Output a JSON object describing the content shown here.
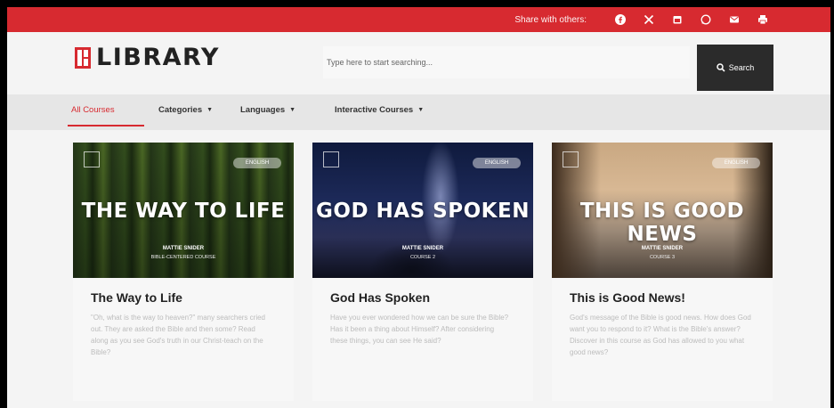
{
  "topbar": {
    "share_label": "Share with others:",
    "icons": [
      "facebook-icon",
      "x-icon",
      "calendar-icon",
      "whatsapp-icon",
      "email-icon",
      "print-icon"
    ]
  },
  "header": {
    "logo_text": "LIBRARY",
    "search_placeholder": "Type here to start searching...",
    "search_button": "Search"
  },
  "nav": {
    "items": [
      {
        "label": "All Courses",
        "active": true
      },
      {
        "label": "Categories",
        "dropdown": true
      },
      {
        "label": "Languages",
        "dropdown": true
      },
      {
        "label": "Interactive Courses",
        "dropdown": true
      }
    ]
  },
  "cards": [
    {
      "cover_title": "THE WAY TO LIFE",
      "badge": "ENGLISH",
      "author": "MATTIE SNIDER",
      "course": "BIBLE-CENTERED COURSE",
      "title": "The Way to Life",
      "description": "\"Oh, what is the way to heaven?\" many searchers cried out. They are asked the Bible and then some? Read along as you see God's truth in our Christ-teach on the Bible?"
    },
    {
      "cover_title": "GOD HAS SPOKEN",
      "badge": "ENGLISH",
      "author": "MATTIE SNIDER",
      "course": "COURSE 2",
      "title": "God Has Spoken",
      "description": "Have you ever wondered how we can be sure the Bible? Has it been a thing about Himself? After considering these things, you can see He said?"
    },
    {
      "cover_title": "THIS IS GOOD NEWS",
      "badge": "ENGLISH",
      "author": "MATTIE SNIDER",
      "course": "COURSE 3",
      "title": "This is Good News!",
      "description": "God's message of the Bible is good news. How does God want you to respond to it? What is the Bible's answer? Discover in this course as God has allowed to you what good news?"
    }
  ],
  "colors": {
    "accent": "#d72a30",
    "dark": "#2b2b2b",
    "background": "#f4f4f4"
  }
}
